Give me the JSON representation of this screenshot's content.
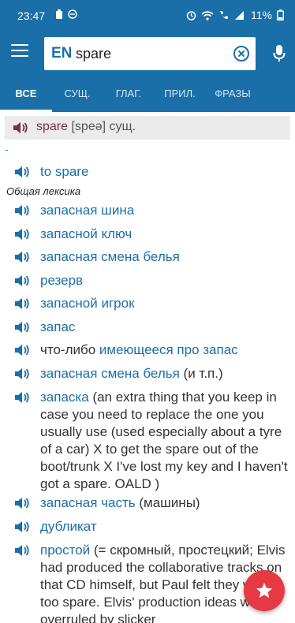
{
  "status_bar": {
    "time": "23:47",
    "battery": "11%"
  },
  "search": {
    "language": "EN",
    "query": "spare"
  },
  "tabs": [
    {
      "label": "ВСЕ",
      "active": true
    },
    {
      "label": "СУЩ."
    },
    {
      "label": "ГЛАГ."
    },
    {
      "label": "ПРИЛ."
    },
    {
      "label": "ФРАЗЫ"
    }
  ],
  "headword": {
    "word": "spare",
    "transcription": "[speə]",
    "pos": "сущ."
  },
  "dash": "-",
  "domain_label": "Общая лексика",
  "verb_entry": {
    "text": "to spare"
  },
  "translations": [
    {
      "link": "запасная шина",
      "extra": ""
    },
    {
      "link": "запасной ключ",
      "extra": ""
    },
    {
      "link": "запасная смена белья",
      "extra": ""
    },
    {
      "link": "резерв",
      "extra": ""
    },
    {
      "link": "запасной игрок",
      "extra": ""
    },
    {
      "link": "запас",
      "extra": ""
    },
    {
      "prefix": "что-либо ",
      "link": "имеющееся про запас",
      "extra": ""
    },
    {
      "link": "запасная смена белья",
      "extra": " (и т.п.)"
    },
    {
      "link": "запаска",
      "extra": " (an extra thing that you keep in case you need to replace the one you usually use (used especially about a tyre of a car) X to get the spare out of the boot/trunk X I've lost my key and I haven't got a spare. OALD )"
    },
    {
      "link": "запасная часть",
      "extra": " (машины)"
    },
    {
      "link": "дубликат",
      "extra": ""
    },
    {
      "link": "простой",
      "extra": " (= скромный, простецкий; Elvis had produced the collaborative tracks on that CD himself, but Paul felt they were too spare. Elvis' production ideas were overruled by slicker"
    }
  ],
  "colors": {
    "primary": "#1a6fa8",
    "headword": "#7a2e4a",
    "fab": "#e53a44"
  },
  "icons": [
    "menu-icon",
    "clear-icon",
    "mic-icon",
    "speaker-icon",
    "star-icon"
  ]
}
